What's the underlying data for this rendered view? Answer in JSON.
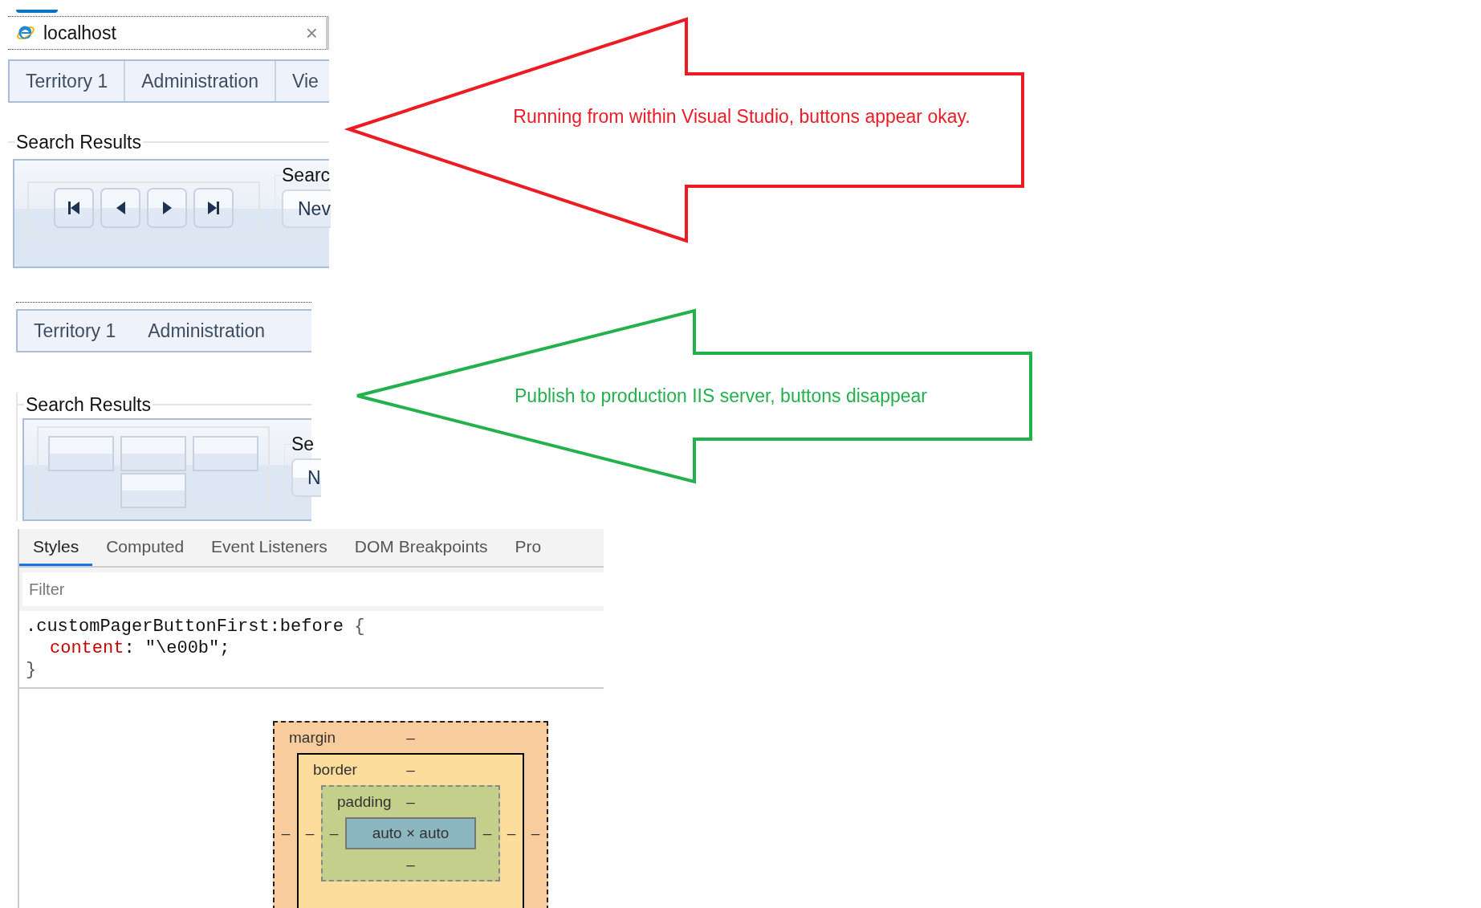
{
  "browser_tab": {
    "title": "localhost",
    "close": "×"
  },
  "panels": [
    {
      "nav_tabs": [
        "Territory 1",
        "Administration",
        "Vie"
      ],
      "section_title": "Search Results",
      "pager_buttons": [
        {
          "kind": "first"
        },
        {
          "kind": "previous"
        },
        {
          "kind": "next"
        },
        {
          "kind": "last"
        }
      ],
      "search_group": {
        "title": "Searc",
        "button": "Nev"
      }
    },
    {
      "nav_tabs": [
        "Territory 1",
        "Administration"
      ],
      "section_title": "Search Results",
      "pager_buttons": [
        {
          "kind": "blank"
        },
        {
          "kind": "blank"
        },
        {
          "kind": "blank"
        },
        {
          "kind": "blank"
        }
      ],
      "search_group": {
        "title": "Se",
        "button": "N"
      }
    }
  ],
  "annotations": [
    {
      "color": "#ed1c24",
      "text": "Running from within Visual Studio, buttons appear okay."
    },
    {
      "color": "#22b14c",
      "text": "Publish to production IIS server, buttons disappear"
    }
  ],
  "devtools": {
    "tabs": [
      {
        "label": "Styles",
        "selected": true
      },
      {
        "label": "Computed",
        "selected": false
      },
      {
        "label": "Event Listeners",
        "selected": false
      },
      {
        "label": "DOM Breakpoints",
        "selected": false
      },
      {
        "label": "Pro",
        "selected": false
      }
    ],
    "filter": {
      "placeholder": "Filter"
    },
    "rule": {
      "selector": ".customPagerButtonFirst:before",
      "open": "{",
      "declarations": [
        {
          "property": "content",
          "separator": ":",
          "value": "\"\\e00b\";"
        }
      ],
      "close": "}"
    },
    "box_model": {
      "margin": {
        "label": "margin",
        "top": "–",
        "left": "–",
        "right": "–"
      },
      "border": {
        "label": "border",
        "top": "–",
        "left": "–",
        "right": "–"
      },
      "padding": {
        "label": "padding",
        "top": "–",
        "left": "–",
        "right": "–",
        "bottom": "–"
      },
      "content": "auto × auto"
    }
  }
}
